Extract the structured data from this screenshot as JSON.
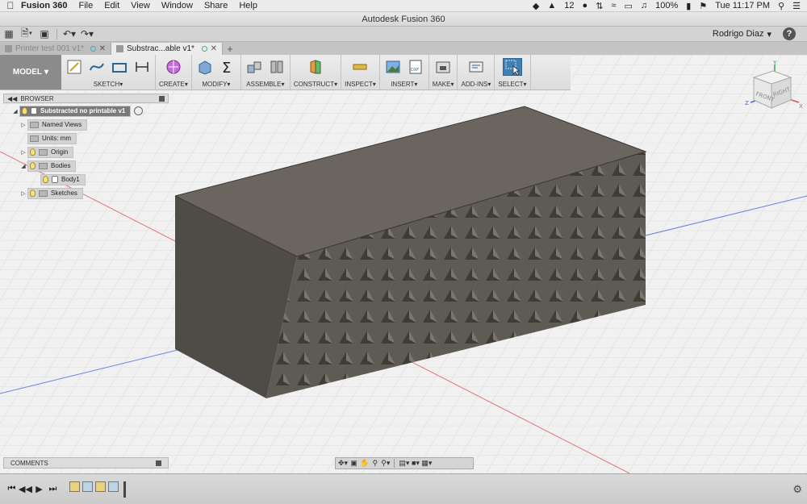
{
  "menubar": {
    "app_name": "Fusion 360",
    "menus": [
      "File",
      "Edit",
      "View",
      "Window",
      "Share",
      "Help"
    ],
    "status": {
      "notifications": "12",
      "battery": "100%",
      "clock": "Tue 11:17 PM"
    }
  },
  "window": {
    "title": "Autodesk Fusion 360"
  },
  "quickbar": {
    "user": "Rodrigo Diaz",
    "help": "?"
  },
  "tabs": [
    {
      "label": "Printer test 001 v1*",
      "active": false
    },
    {
      "label": "Substrac...able v1*",
      "active": true
    }
  ],
  "toolbar": {
    "workspace": "MODEL",
    "groups": [
      "SKETCH",
      "CREATE",
      "MODIFY",
      "ASSEMBLE",
      "CONSTRUCT",
      "INSPECT",
      "INSERT",
      "MAKE",
      "ADD-INS",
      "SELECT"
    ]
  },
  "browser": {
    "title": "BROWSER",
    "items": [
      {
        "label": "Substracted no printable v1"
      },
      {
        "label": "Named Views"
      },
      {
        "label": "Units: mm"
      },
      {
        "label": "Origin"
      },
      {
        "label": "Bodies"
      },
      {
        "label": "Body1"
      },
      {
        "label": "Sketches"
      }
    ]
  },
  "viewcube": {
    "face_front": "FRONT",
    "face_right": "RIGHT",
    "axis_x": "X",
    "axis_y": "Y",
    "axis_z": "Z"
  },
  "comments": {
    "title": "COMMENTS"
  },
  "colors": {
    "accent": "#3f7fb2",
    "model_grey": "#5e5a54",
    "grid": "#dcdcdc",
    "axis_red": "#e25454",
    "axis_blue": "#4a66e2"
  }
}
